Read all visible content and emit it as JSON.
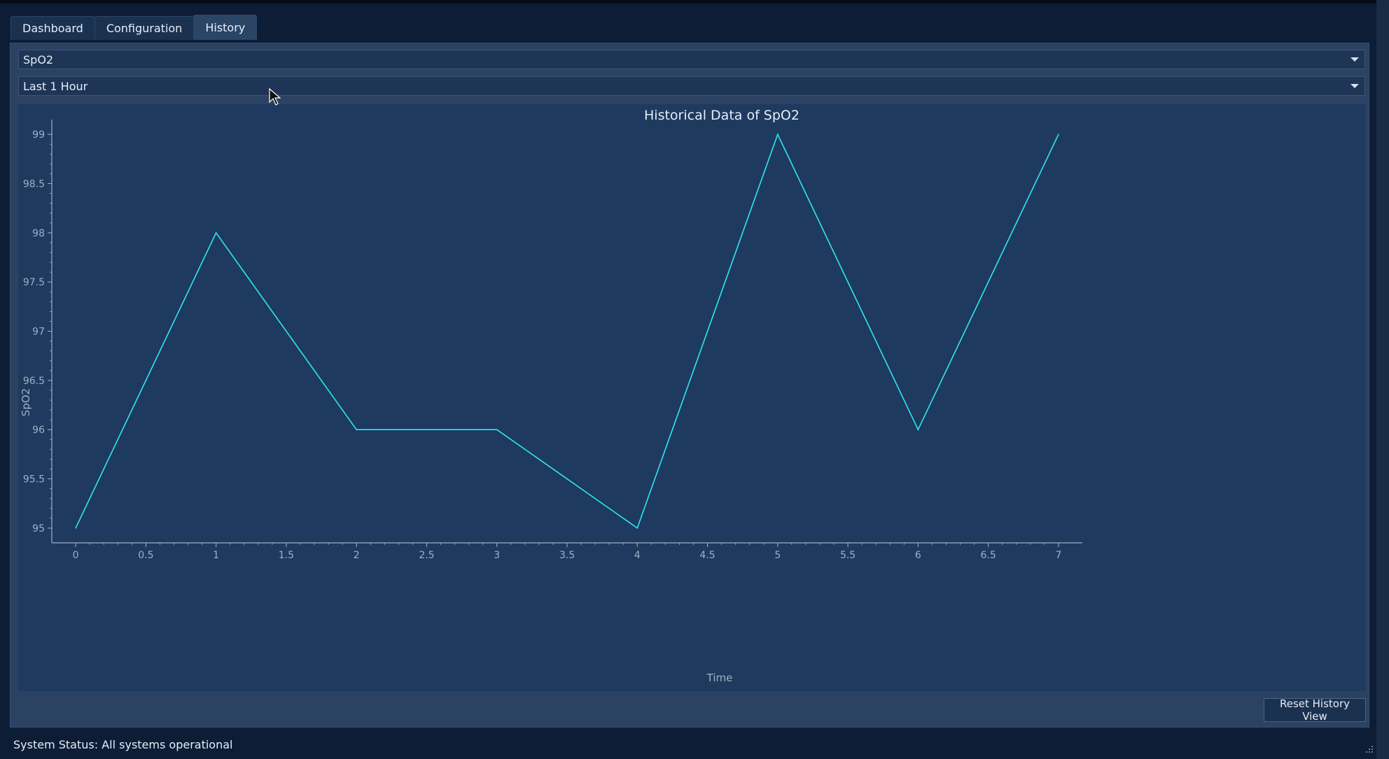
{
  "tabs": [
    {
      "label": "Dashboard",
      "active": false
    },
    {
      "label": "Configuration",
      "active": false
    },
    {
      "label": "History",
      "active": true
    }
  ],
  "parameter_select": {
    "value": "SpO2"
  },
  "range_select": {
    "value": "Last 1 Hour"
  },
  "reset_button": {
    "label": "Reset History View"
  },
  "status": {
    "text": "System Status: All systems operational"
  },
  "colors": {
    "line": "#2ee6f0",
    "chart_bg": "#1e3a5f",
    "axis": "#9fb0c4"
  },
  "chart_data": {
    "type": "line",
    "title": "Historical Data of SpO2",
    "xlabel": "Time",
    "ylabel": "SpO2",
    "x": [
      0,
      1,
      2,
      3,
      4,
      5,
      6,
      7
    ],
    "series": [
      {
        "values": [
          95,
          98,
          96,
          96,
          95,
          99,
          96,
          99
        ]
      }
    ],
    "xlim": [
      -0.17,
      7.17
    ],
    "ylim": [
      94.85,
      99.15
    ],
    "xticks": [
      "0",
      "0.5",
      "1",
      "1.5",
      "2",
      "2.5",
      "3",
      "3.5",
      "4",
      "4.5",
      "5",
      "5.5",
      "6",
      "6.5",
      "7"
    ],
    "yticks": [
      "95",
      "95.5",
      "96",
      "96.5",
      "97",
      "97.5",
      "98",
      "98.5",
      "99"
    ],
    "grid": false
  }
}
